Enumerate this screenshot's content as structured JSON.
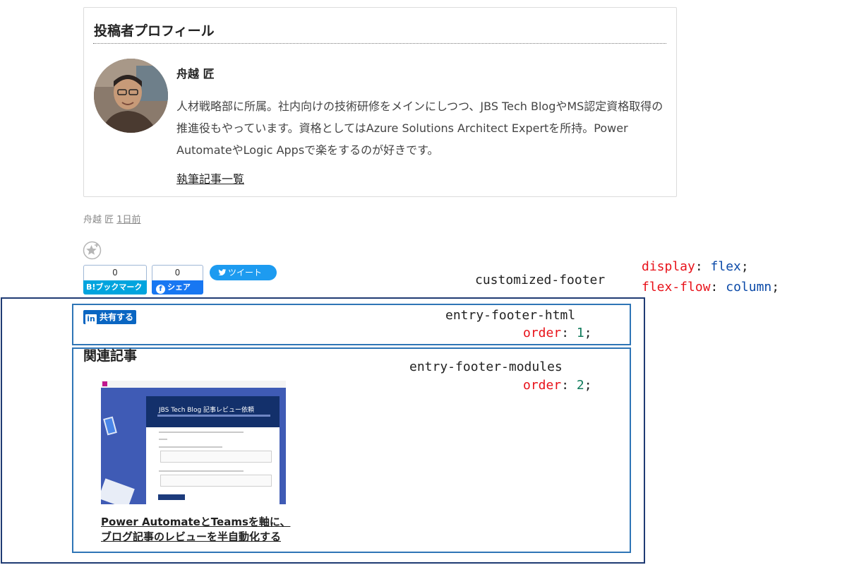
{
  "profile": {
    "heading": "投稿者プロフィール",
    "name": "舟越 匠",
    "bio": "人材戦略部に所属。社内向けの技術研修をメインにしつつ、JBS Tech BlogやMS認定資格取得の推進役もやっています。資格としてはAzure Solutions Architect Expertを所持。Power AutomateやLogic Appsで楽をするのが好きです。",
    "articles_link": "執筆記事一覧"
  },
  "meta": {
    "author": "舟越 匠",
    "date": "1日前"
  },
  "share": {
    "hatena_count": "0",
    "hatena_label": "B!ブックマーク",
    "facebook_count": "0",
    "facebook_label": "シェア",
    "facebook_icon": "f",
    "tweet_label": "ツイート",
    "linkedin_icon": "in",
    "linkedin_label": "共有する"
  },
  "annotations": {
    "customized_footer": "customized-footer",
    "css_prop_1": "display",
    "css_val_1": "flex",
    "css_prop_2": "flex-flow",
    "css_val_2": "column",
    "entry_footer_html": "entry-footer-html",
    "entry_footer_modules": "entry-footer-modules",
    "order_prop": "order",
    "order_1": "1",
    "order_2": "2"
  },
  "related": {
    "heading": "関連記事",
    "thumbnail_title": "JBS Tech Blog 記事レビュー依頼",
    "article_title": "Power AutomateとTeamsを軸に、ブログ記事のレビューを半自動化する"
  },
  "colors": {
    "frame_outer": "#1f3b73",
    "frame_inner": "#2e75b6",
    "css_keyword": "#e8121a",
    "css_value": "#0b4aa8",
    "css_number": "#0f7b5b"
  }
}
